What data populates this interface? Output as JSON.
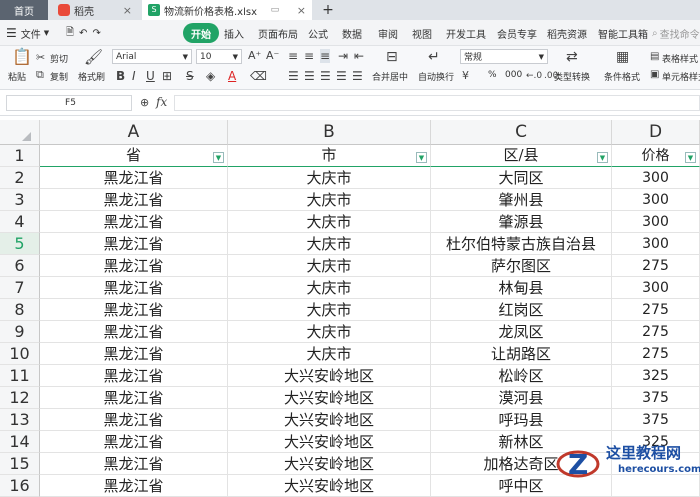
{
  "tabs": [
    {
      "label": "首页"
    },
    {
      "label": "稻壳",
      "close": "×"
    },
    {
      "label": "物流新价格表格.xlsx",
      "close": "×"
    }
  ],
  "tabbar": {
    "new_tab": "+"
  },
  "menu": {
    "file": "文件",
    "items": [
      "开始",
      "插入",
      "页面布局",
      "公式",
      "数据",
      "审阅",
      "视图",
      "开发工具",
      "会员专享",
      "稻壳资源",
      "智能工具箱"
    ],
    "active": "开始",
    "search_hint": "查找命令"
  },
  "toolbar": {
    "paste": "粘贴",
    "cut": "剪切",
    "copy": "复制",
    "format_painter": "格式刷",
    "font_name": "Arial",
    "font_size": "10",
    "merge_center": "合并居中",
    "wrap_text": "自动换行",
    "number_format": "常规",
    "type_convert": "类型转换",
    "conditional_format": "条件格式",
    "table_style": "表格样式",
    "cell_style": "单元格样式",
    "percent": "%",
    "thousands": "000"
  },
  "formula_bar": {
    "name_box": "F5",
    "fx": "fx",
    "zoom": "⊕"
  },
  "columns": [
    "A",
    "B",
    "C",
    "D"
  ],
  "header_row": {
    "row": "1",
    "cells": [
      "省",
      "市",
      "区/县",
      "价格"
    ]
  },
  "rows": [
    {
      "row": "2",
      "cells": [
        "黑龙江省",
        "大庆市",
        "大同区",
        "300"
      ]
    },
    {
      "row": "3",
      "cells": [
        "黑龙江省",
        "大庆市",
        "肇州县",
        "300"
      ]
    },
    {
      "row": "4",
      "cells": [
        "黑龙江省",
        "大庆市",
        "肇源县",
        "300"
      ]
    },
    {
      "row": "5",
      "cells": [
        "黑龙江省",
        "大庆市",
        "杜尔伯特蒙古族自治县",
        "300"
      ]
    },
    {
      "row": "6",
      "cells": [
        "黑龙江省",
        "大庆市",
        "萨尔图区",
        "275"
      ]
    },
    {
      "row": "7",
      "cells": [
        "黑龙江省",
        "大庆市",
        "林甸县",
        "300"
      ]
    },
    {
      "row": "8",
      "cells": [
        "黑龙江省",
        "大庆市",
        "红岗区",
        "275"
      ]
    },
    {
      "row": "9",
      "cells": [
        "黑龙江省",
        "大庆市",
        "龙凤区",
        "275"
      ]
    },
    {
      "row": "10",
      "cells": [
        "黑龙江省",
        "大庆市",
        "让胡路区",
        "275"
      ]
    },
    {
      "row": "11",
      "cells": [
        "黑龙江省",
        "大兴安岭地区",
        "松岭区",
        "325"
      ]
    },
    {
      "row": "12",
      "cells": [
        "黑龙江省",
        "大兴安岭地区",
        "漠河县",
        "375"
      ]
    },
    {
      "row": "13",
      "cells": [
        "黑龙江省",
        "大兴安岭地区",
        "呼玛县",
        "375"
      ]
    },
    {
      "row": "14",
      "cells": [
        "黑龙江省",
        "大兴安岭地区",
        "新林区",
        "325"
      ]
    },
    {
      "row": "15",
      "cells": [
        "黑龙江省",
        "大兴安岭地区",
        "加格达奇区",
        ""
      ]
    },
    {
      "row": "16",
      "cells": [
        "黑龙江省",
        "大兴安岭地区",
        "呼中区",
        ""
      ]
    }
  ],
  "selected_row": "5",
  "watermark": {
    "title": "这里教程网",
    "url": "herecours.com"
  },
  "colors": {
    "accent": "#21a366",
    "pill": "#21a366"
  }
}
